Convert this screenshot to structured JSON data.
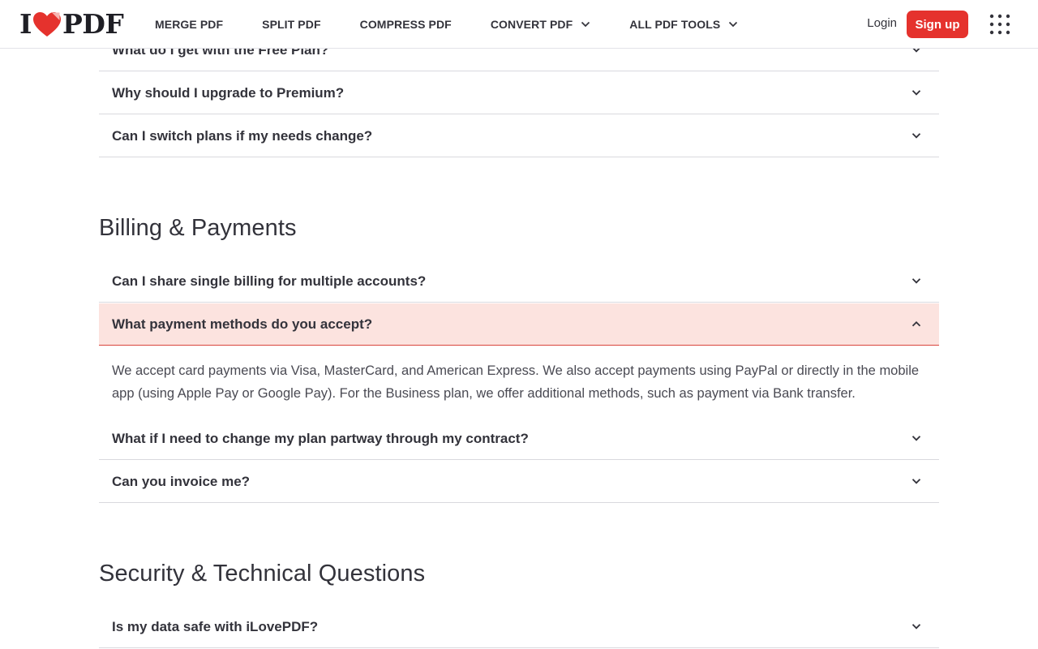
{
  "brand": {
    "logo_left": "I",
    "logo_right": "PDF",
    "accent": "#e5322d"
  },
  "nav": {
    "items": [
      {
        "label": "MERGE PDF"
      },
      {
        "label": "SPLIT PDF"
      },
      {
        "label": "COMPRESS PDF"
      },
      {
        "label": "CONVERT PDF",
        "dropdown": true
      },
      {
        "label": "ALL PDF TOOLS",
        "dropdown": true
      }
    ],
    "login": "Login",
    "signup": "Sign up",
    "apps_icon": "grid-dots-icon"
  },
  "plans_faq": [
    {
      "q": "What do I get with the Free Plan?"
    },
    {
      "q": "Why should I upgrade to Premium?"
    },
    {
      "q": "Can I switch plans if my needs change?"
    }
  ],
  "billing": {
    "title": "Billing & Payments",
    "items": [
      {
        "q": "Can I share single billing for multiple accounts?"
      },
      {
        "q": "What payment methods do you accept?",
        "expanded": true,
        "answer": "We accept card payments via Visa, MasterCard, and American Express. We also accept payments using PayPal or directly in the mobile app (using Apple Pay or Google Pay). For the Business plan, we offer additional methods, such as payment via Bank transfer."
      },
      {
        "q": "What if I need to change my plan partway through my contract?"
      },
      {
        "q": "Can you invoice me?"
      }
    ]
  },
  "security": {
    "title": "Security & Technical Questions",
    "items": [
      {
        "q": "Is my data safe with iLovePDF?"
      }
    ]
  },
  "colors": {
    "expanded_bg": "#fce3df",
    "expanded_border": "#d9453c",
    "text": "#33333b"
  }
}
